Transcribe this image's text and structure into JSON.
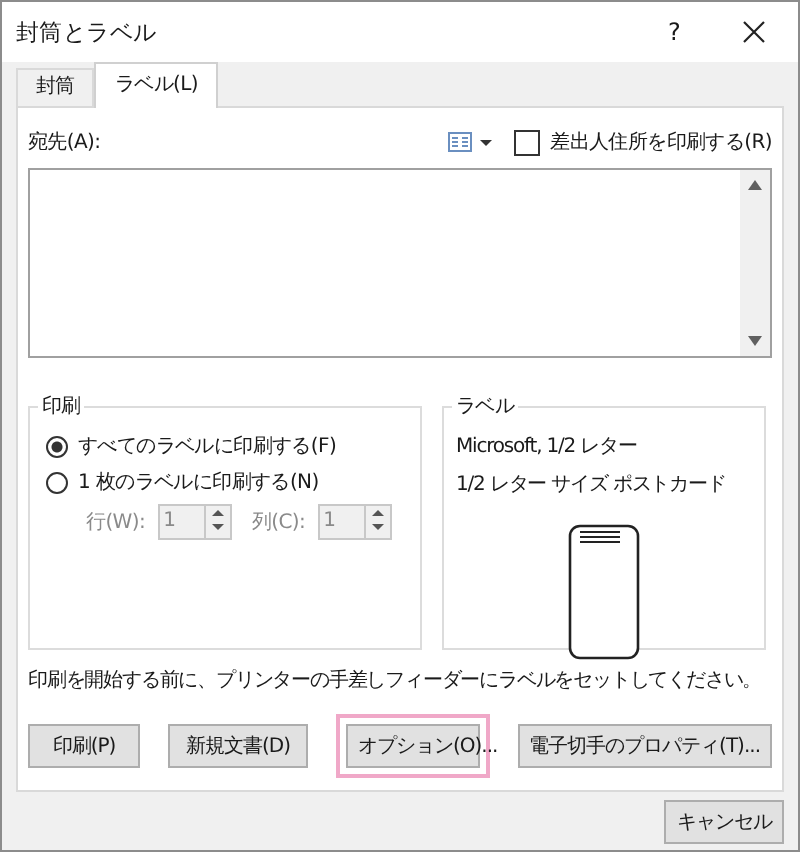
{
  "window": {
    "title": "封筒とラベル",
    "help": "?"
  },
  "tabs": [
    {
      "label": "封筒",
      "selected": false
    },
    {
      "label": "ラベル(L)",
      "selected": true
    }
  ],
  "address": {
    "label": "宛先(A):",
    "return_address": {
      "label": "差出人住所を印刷する(R)",
      "checked": false
    }
  },
  "print_group": {
    "title": "印刷",
    "options": [
      {
        "label": "すべてのラベルに印刷する(F)",
        "selected": true
      },
      {
        "label": "1 枚のラベルに印刷する(N)",
        "selected": false
      }
    ],
    "spinners": [
      {
        "label": "行(W):",
        "value": "1",
        "disabled": true
      },
      {
        "label": "列(C):",
        "value": "1",
        "disabled": true
      }
    ]
  },
  "label_group": {
    "title": "ラベル",
    "lines": [
      "Microsoft, 1/2 レター",
      "1/2 レター サイズ ポストカード"
    ]
  },
  "note": "印刷を開始する前に、プリンターの手差しフィーダーにラベルをセットしてください。",
  "buttons": [
    {
      "label": "印刷(P)",
      "highlighted": false
    },
    {
      "label": "新規文書(D)",
      "highlighted": false
    },
    {
      "label": "オプション(O)...",
      "highlighted": true
    },
    {
      "label": "電子切手のプロパティ(T)...",
      "highlighted": false
    }
  ],
  "cancel": "キャンセル"
}
